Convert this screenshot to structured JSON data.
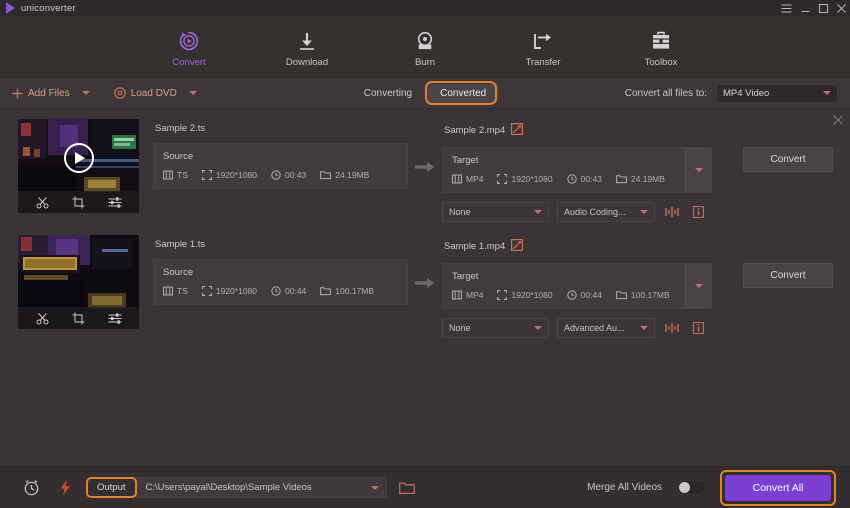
{
  "window": {
    "brand": "uniconverter",
    "controls": [
      {
        "name": "menu-icon",
        "glyph": "☰"
      },
      {
        "name": "minimize-icon",
        "glyph": "–"
      },
      {
        "name": "maximize-icon",
        "glyph": "□"
      },
      {
        "name": "close-icon",
        "glyph": "✕"
      }
    ]
  },
  "nav": {
    "items": [
      {
        "label": "Convert",
        "icon": "convert-icon",
        "active": true
      },
      {
        "label": "Download",
        "icon": "download-icon",
        "active": false
      },
      {
        "label": "Burn",
        "icon": "burn-icon",
        "active": false
      },
      {
        "label": "Transfer",
        "icon": "transfer-icon",
        "active": false
      },
      {
        "label": "Toolbox",
        "icon": "toolbox-icon",
        "active": false
      }
    ],
    "accent_color": "#9b6ae0"
  },
  "toolbar": {
    "add_files": "Add Files",
    "load_dvd": "Load DVD",
    "tabs": [
      {
        "label": "Converting",
        "selected": false
      },
      {
        "label": "Converted",
        "selected": true,
        "highlighted": true
      }
    ],
    "convert_all_to_label": "Convert all files to:",
    "convert_all_to_value": "MP4 Video",
    "accent_color": "#d6a48d",
    "highlight_color": "#e2822c"
  },
  "files": [
    {
      "source_name": "Sample 2.ts",
      "target_name": "Sample 2.mp4",
      "source": {
        "title": "Source",
        "format": "TS",
        "resolution": "1920*1080",
        "duration": "00:43",
        "size": "24.19MB"
      },
      "target": {
        "title": "Target",
        "format": "MP4",
        "resolution": "1920*1080",
        "duration": "00:43",
        "size": "24.19MB"
      },
      "subtitle_option": "None",
      "audio_option": "Audio Coding...",
      "convert_label": "Convert",
      "has_play_button": true
    },
    {
      "source_name": "Sample 1.ts",
      "target_name": "Sample 1.mp4",
      "source": {
        "title": "Source",
        "format": "TS",
        "resolution": "1920*1080",
        "duration": "00:44",
        "size": "100.17MB"
      },
      "target": {
        "title": "Target",
        "format": "MP4",
        "resolution": "1920*1080",
        "duration": "00:44",
        "size": "100.17MB"
      },
      "subtitle_option": "None",
      "audio_option": "Advanced Au...",
      "convert_label": "Convert",
      "has_play_button": false
    }
  ],
  "bottom": {
    "output_label": "Output",
    "output_path": "C:\\Users\\payal\\Desktop\\Sample Videos",
    "merge_label": "Merge All Videos",
    "merge_on": false,
    "convert_all_label": "Convert All",
    "convert_all_color": "#7b3fd4",
    "highlight_color": "#e2822c"
  }
}
